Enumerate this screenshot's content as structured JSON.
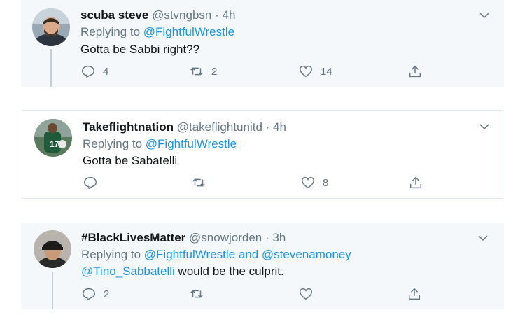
{
  "tweets": [
    {
      "name": "scuba steve",
      "handle": "@stvngbsn",
      "time": "· 4h",
      "replying_label": "Replying to ",
      "reply_to_1": "@FightfulWrestle",
      "reply_joiner": "",
      "reply_to_2": "",
      "mention": "",
      "text": "Gotta be Sabbi right??",
      "reply_count": "4",
      "retweet_count": "2",
      "like_count": "14"
    },
    {
      "name": "Takeflightnation",
      "handle": "@takeflightunitd",
      "time": "· 4h",
      "replying_label": "Replying to ",
      "reply_to_1": "@FightfulWrestle",
      "reply_joiner": "",
      "reply_to_2": "",
      "mention": "",
      "text": "Gotta be Sabatelli",
      "reply_count": "",
      "retweet_count": "",
      "like_count": "8"
    },
    {
      "name": "#BlackLivesMatter",
      "handle": "@snowjorden",
      "time": "· 3h",
      "replying_label": "Replying to ",
      "reply_to_1": "@FightfulWrestle",
      "reply_joiner": " and ",
      "reply_to_2": "@stevenamoney",
      "mention": "@Tino_Sabbatelli",
      "text": " would be the culprit.",
      "reply_count": "2",
      "retweet_count": "",
      "like_count": ""
    }
  ],
  "icons": {
    "reply": "reply-icon",
    "retweet": "retweet-icon",
    "like": "heart-icon",
    "share": "share-icon",
    "more": "chevron-down-icon"
  },
  "colors": {
    "link": "#1b95e0",
    "secondary": "#657786",
    "primary": "#14171a",
    "shaded_bg": "#f5f8fa",
    "border": "#e1e8ed"
  }
}
